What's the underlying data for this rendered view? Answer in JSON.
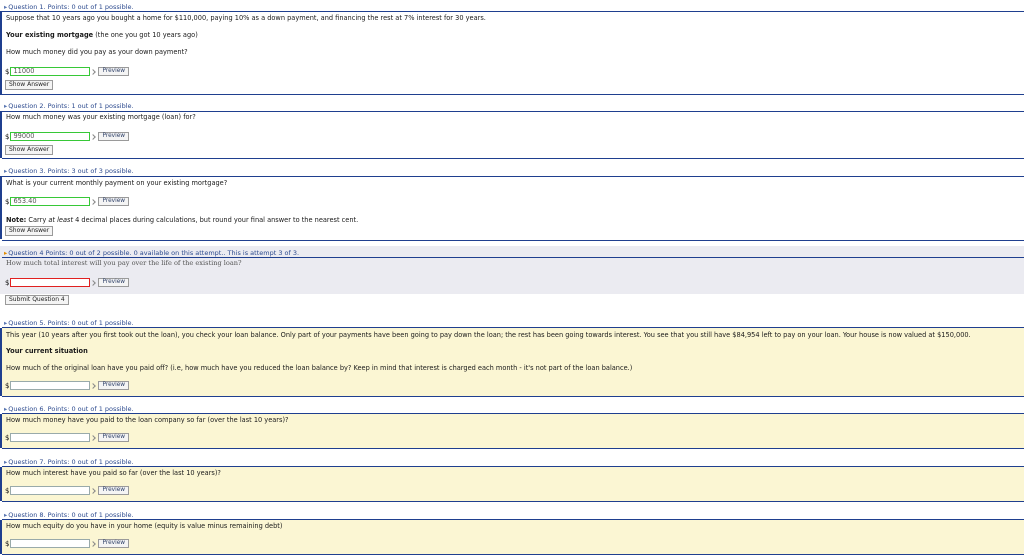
{
  "q1": {
    "header": "Question 1. Points: 0 out of 1 possible.",
    "intro": "Suppose that 10 years ago you bought a home for $110,000, paying 10% as a down payment, and financing the rest at 7% interest for 30 years.",
    "section_bold": "Your existing mortgage",
    "section_rest": " (the one you got 10 years ago)",
    "question": "How much money did you pay as your down payment?",
    "answer": "11000",
    "preview": "Preview",
    "show_answer": "Show Answer"
  },
  "q2": {
    "header": "Question 2. Points: 1 out of 1 possible.",
    "question": "How much money was your existing mortgage (loan) for?",
    "answer": "99000",
    "preview": "Preview",
    "show_answer": "Show Answer"
  },
  "q3": {
    "header": "Question 3. Points: 3 out of 3 possible.",
    "question": "What is your current monthly payment on your existing mortgage?",
    "answer": "653.40",
    "preview": "Preview",
    "note_bold": "Note:",
    "note_mid1": " Carry ",
    "note_italic": "at least",
    "note_mid2": " 4 decimal places during calculations, but round your final answer to the nearest cent.",
    "show_answer": "Show Answer"
  },
  "q4": {
    "header": "Question 4 Points: 0 out of 2 possible. 0 available on this attempt.. This is attempt 3 of 3.",
    "question": "How much total interest will you pay over the life of the existing loan?",
    "answer": "",
    "preview": "Preview",
    "submit": "Submit Question 4"
  },
  "q5": {
    "header": "Question 5. Points: 0 out of 1 possible.",
    "intro": "This year (10 years after you first took out the loan), you check your loan balance. Only part of your payments have been going to pay down the loan; the rest has been going towards interest. You see that you still have $84,954 left to pay on your loan. Your house is now valued at $150,000.",
    "section": "Your current situation",
    "question": "How much of the original loan have you paid off? (i.e, how much have you reduced the loan balance by? Keep in mind that interest is charged each month - it's not part of the loan balance.)",
    "answer": "",
    "preview": "Preview"
  },
  "q6": {
    "header": "Question 6. Points: 0 out of 1 possible.",
    "question": "How much money have you paid to the loan company so far (over the last 10 years)?",
    "answer": "",
    "preview": "Preview"
  },
  "q7": {
    "header": "Question 7. Points: 0 out of 1 possible.",
    "question": "How much interest have you paid so far (over the last 10 years)?",
    "answer": "",
    "preview": "Preview"
  },
  "q8": {
    "header": "Question 8. Points: 0 out of 1 possible.",
    "question": "How much equity do you have in your home (equity is value minus remaining debt)",
    "answer": "",
    "preview": "Preview"
  },
  "dollar": "$",
  "icons": {
    "collapse": "triangle-icon",
    "current": "arrow-icon"
  },
  "colors": {
    "header_blue": "#2c4a8e",
    "rule_blue": "#1f3f8f",
    "correct_green": "#37c837",
    "incorrect_red": "#e02020",
    "unanswered_bg": "#fbf6d3",
    "active_bg": "#ebebf1"
  }
}
